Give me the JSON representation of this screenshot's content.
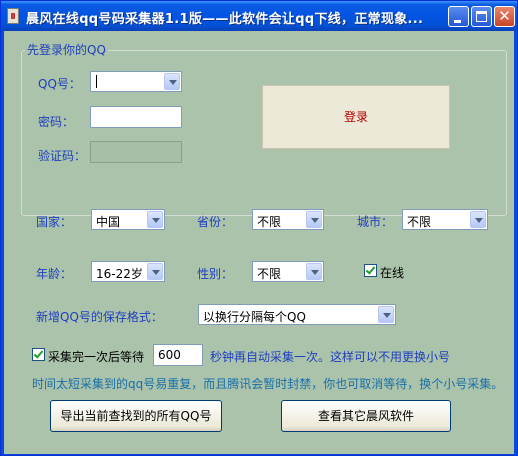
{
  "window": {
    "title": "晨风在线qq号码采集器1.1版——此软件会让qq下线，正常现象..."
  },
  "login": {
    "group_title": "先登录你的QQ",
    "qq_label": "QQ号：",
    "qq_value": "",
    "password_label": "密码：",
    "password_value": "",
    "captcha_label": "验证码：",
    "captcha_value": "",
    "login_button": "登录"
  },
  "filters": {
    "country_label": "国家：",
    "country_value": "中国",
    "province_label": "省份：",
    "province_value": "不限",
    "city_label": "城市：",
    "city_value": "不限",
    "age_label": "年龄：",
    "age_value": "16-22岁",
    "gender_label": "性别：",
    "gender_value": "不限",
    "online_label": "在线",
    "online_checked": true
  },
  "save_format": {
    "label": "新增QQ号的保存格式：",
    "value": "以换行分隔每个QQ"
  },
  "wait": {
    "checkbox_label": "采集完一次后等待",
    "checked": true,
    "seconds": "600",
    "suffix": "秒钟再自动采集一次。这样可以不用更换小号",
    "note": "时间太短采集到的qq号易重复，而且腾讯会暂时封禁，你也可取消等待，换个小号采集。"
  },
  "buttons": {
    "export": "导出当前查找到的所有QQ号",
    "other_software": "查看其它晨风软件"
  },
  "colors": {
    "client_bg": "#aac3aa",
    "label_blue": "#1f3fbf",
    "note_teal": "#1a6fa8",
    "login_text": "#b00000",
    "titlebar": "#0454e4"
  }
}
